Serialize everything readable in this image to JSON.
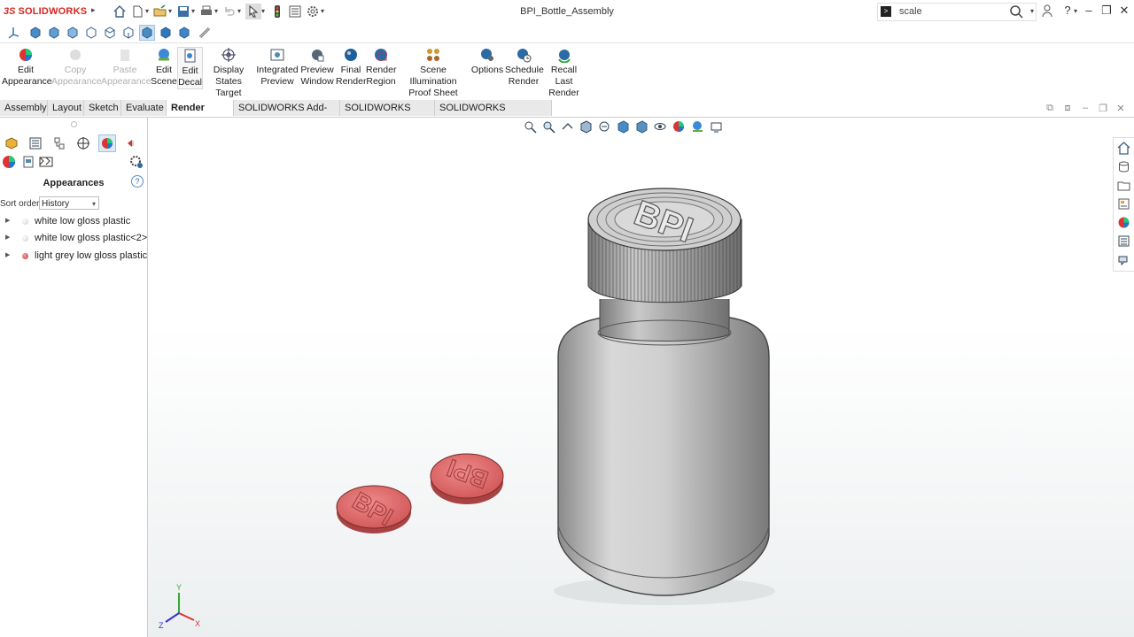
{
  "app": {
    "brand_prefix": "3S",
    "brand_name": "SOLIDWORKS",
    "doc_title": "BPI_Bottle_Assembly"
  },
  "search": {
    "value": "scale"
  },
  "ribbon": {
    "buttons": [
      {
        "line1": "Edit",
        "line2": "Appearance",
        "enabled": true
      },
      {
        "line1": "Copy",
        "line2": "Appearance",
        "enabled": false
      },
      {
        "line1": "Paste",
        "line2": "Appearance",
        "enabled": false
      },
      {
        "line1": "Edit",
        "line2": "Scene",
        "enabled": true
      },
      {
        "line1": "Edit",
        "line2": "Decal",
        "enabled": true
      },
      {
        "line1": "Display",
        "line2": "States Target",
        "enabled": true
      },
      {
        "line1": "Integrated",
        "line2": "Preview",
        "enabled": true
      },
      {
        "line1": "Preview",
        "line2": "Window",
        "enabled": true
      },
      {
        "line1": "Final",
        "line2": "Render",
        "enabled": true
      },
      {
        "line1": "Render",
        "line2": "Region",
        "enabled": true
      },
      {
        "line1": "Scene Illumination",
        "line2": "Proof Sheet",
        "enabled": true
      },
      {
        "line1": "Options",
        "line2": "",
        "enabled": true
      },
      {
        "line1": "Schedule",
        "line2": "Render",
        "enabled": true
      },
      {
        "line1": "Recall Last",
        "line2": "Render",
        "enabled": true
      }
    ]
  },
  "tabs": [
    "Assembly",
    "Layout",
    "Sketch",
    "Evaluate",
    "Render Tools",
    "SOLIDWORKS Add-Ins",
    "SOLIDWORKS MBD",
    "SOLIDWORKS Inspection"
  ],
  "active_tab": "Render Tools",
  "panel": {
    "title": "Appearances",
    "help": "?",
    "sort_label": "Sort order:",
    "sort_value": "History",
    "items": [
      {
        "label": "white low gloss plastic",
        "color": "#e6e6e6"
      },
      {
        "label": "white low gloss plastic<2>",
        "color": "#e6e6e6"
      },
      {
        "label": "light grey low gloss plastic",
        "color": "#d9534f"
      }
    ]
  },
  "triad": {
    "x": "X",
    "y": "Y",
    "z": "Z"
  },
  "colors": {
    "pill_red": "#e27070",
    "bottle_grey": "#cfcfcf",
    "accent": "#2d6aa6",
    "brand": "#d6261f"
  },
  "cap_text": "BPI"
}
